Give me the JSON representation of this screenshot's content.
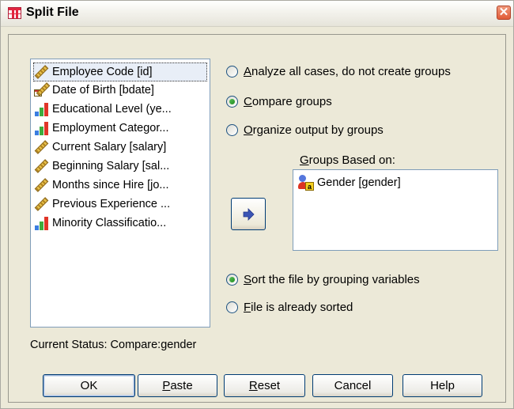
{
  "window": {
    "title": "Split File",
    "close_glyph": "✕"
  },
  "variables": [
    {
      "label": "Employee Code [id]",
      "icon": "ruler-icon",
      "selected": true
    },
    {
      "label": "Date of Birth [bdate]",
      "icon": "calendar-ruler-icon"
    },
    {
      "label": "Educational Level (ye...",
      "icon": "bar-chart-icon"
    },
    {
      "label": "Employment Categor...",
      "icon": "bar-chart-icon"
    },
    {
      "label": "Current Salary [salary]",
      "icon": "ruler-icon"
    },
    {
      "label": "Beginning Salary [sal...",
      "icon": "ruler-icon"
    },
    {
      "label": "Months since Hire [jo...",
      "icon": "ruler-icon"
    },
    {
      "label": "Previous Experience ...",
      "icon": "ruler-icon"
    },
    {
      "label": "Minority Classificatio...",
      "icon": "bar-chart-icon"
    }
  ],
  "options": {
    "analyze_all": {
      "mnemonic": "A",
      "rest": "nalyze all cases, do not create groups",
      "selected": false
    },
    "compare": {
      "mnemonic": "C",
      "rest": "ompare groups",
      "selected": true
    },
    "organize": {
      "mnemonic": "O",
      "rest": "rganize output by groups",
      "selected": false
    }
  },
  "groups": {
    "label_mnemonic": "G",
    "label_rest": "roups Based on:",
    "items": [
      {
        "label": "Gender [gender]",
        "icon": "nominal-person-icon"
      }
    ]
  },
  "sort": {
    "sort_file": {
      "mnemonic": "S",
      "rest": "ort the file by grouping variables",
      "selected": true
    },
    "already_sorted": {
      "mnemonic": "F",
      "rest": "ile is already sorted",
      "selected": false
    }
  },
  "status": "Current Status: Compare:gender",
  "buttons": {
    "ok": "OK",
    "paste_mn": "P",
    "paste_rest": "aste",
    "reset_mn": "R",
    "reset_rest": "eset",
    "cancel": "Cancel",
    "help": "Help"
  },
  "colors": {
    "dialog_bg": "#ece9d8",
    "button_border": "#003c74",
    "radio_dot": "#2a9a2a",
    "list_border": "#7f9db9"
  }
}
